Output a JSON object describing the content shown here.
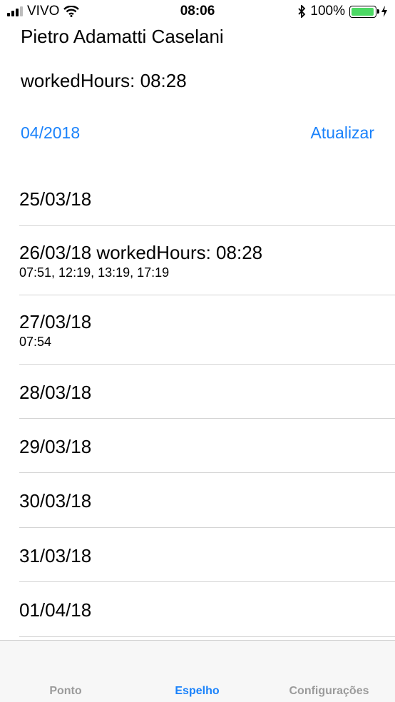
{
  "status_bar": {
    "carrier": "VIVO",
    "time": "08:06",
    "battery_percent": "100%",
    "battery_level": 1.0,
    "battery_color": "#4cd964"
  },
  "header": {
    "name": "Pietro Adamatti Caselani",
    "worked_summary": "workedHours: 08:28",
    "month": "04/2018",
    "refresh_label": "Atualizar"
  },
  "days": [
    {
      "title": "25/03/18",
      "punches": ""
    },
    {
      "title": "26/03/18 workedHours: 08:28",
      "punches": "07:51, 12:19, 13:19, 17:19"
    },
    {
      "title": "27/03/18",
      "punches": "07:54"
    },
    {
      "title": "28/03/18",
      "punches": ""
    },
    {
      "title": "29/03/18",
      "punches": ""
    },
    {
      "title": "30/03/18",
      "punches": ""
    },
    {
      "title": "31/03/18",
      "punches": ""
    },
    {
      "title": "01/04/18",
      "punches": ""
    }
  ],
  "tabs": [
    {
      "label": "Ponto",
      "active": false
    },
    {
      "label": "Espelho",
      "active": true
    },
    {
      "label": "Configurações",
      "active": false
    }
  ],
  "colors": {
    "accent": "#1a82fb",
    "inactive_tab": "#9b9b9b"
  }
}
